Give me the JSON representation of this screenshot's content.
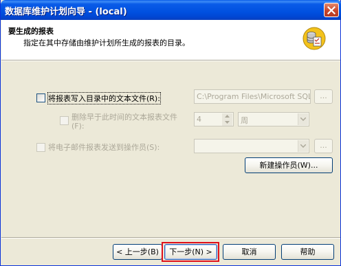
{
  "window": {
    "title": "数据库维护计划向导 - (local)",
    "close_icon": "close-icon"
  },
  "header": {
    "title": "要生成的报表",
    "subtitle": "指定在其中存储由维护计划所生成的报表的目录。",
    "icon": "database-report-icon"
  },
  "report_file": {
    "label": "将报表写入目录中的文本文件(R):",
    "path_value": "C:\\Program Files\\Microsoft SQL Se",
    "browse_label": "...",
    "checked": false
  },
  "delete_old": {
    "label": "删除早于此时间的文本报表文件",
    "label2": "(F):",
    "amount": "4",
    "unit": "周",
    "checked": false
  },
  "email": {
    "label": "将电子邮件报表发送到操作员(S):",
    "operator_value": "",
    "browse_label": "...",
    "checked": false
  },
  "new_operator_button": "新建操作员(W)...",
  "footer": {
    "back_button": "< 上一步(B)",
    "next_button": "下一步(N) >",
    "cancel_button": "取消",
    "help_button": "帮助"
  }
}
